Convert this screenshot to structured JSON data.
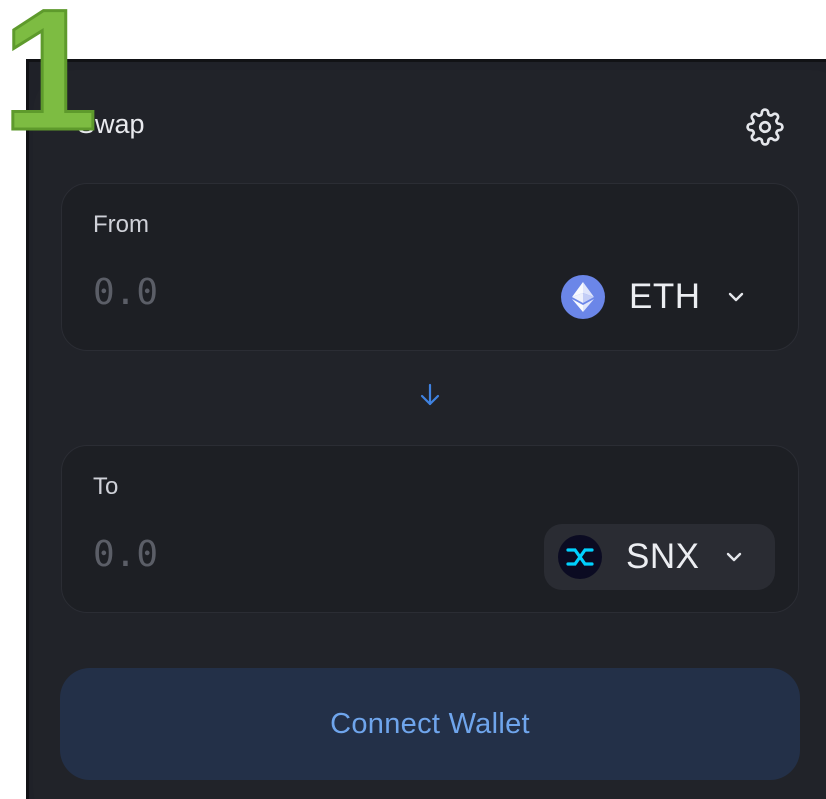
{
  "step_badge": "1",
  "swap": {
    "title": "Swap",
    "settings_icon": "gear-icon"
  },
  "from": {
    "label": "From",
    "amount_placeholder": "0.0",
    "token": {
      "symbol": "ETH",
      "icon": "ethereum-icon",
      "icon_color": "#6b86e8"
    }
  },
  "switch_icon": "arrow-down-icon",
  "to": {
    "label": "To",
    "amount_placeholder": "0.0",
    "token": {
      "symbol": "SNX",
      "icon": "synthetix-icon",
      "icon_color": "#00d1ff"
    }
  },
  "connect_wallet_label": "Connect Wallet",
  "colors": {
    "background": "#212329",
    "accent": "#6fa5ec",
    "step_badge": "#7dbc42"
  }
}
